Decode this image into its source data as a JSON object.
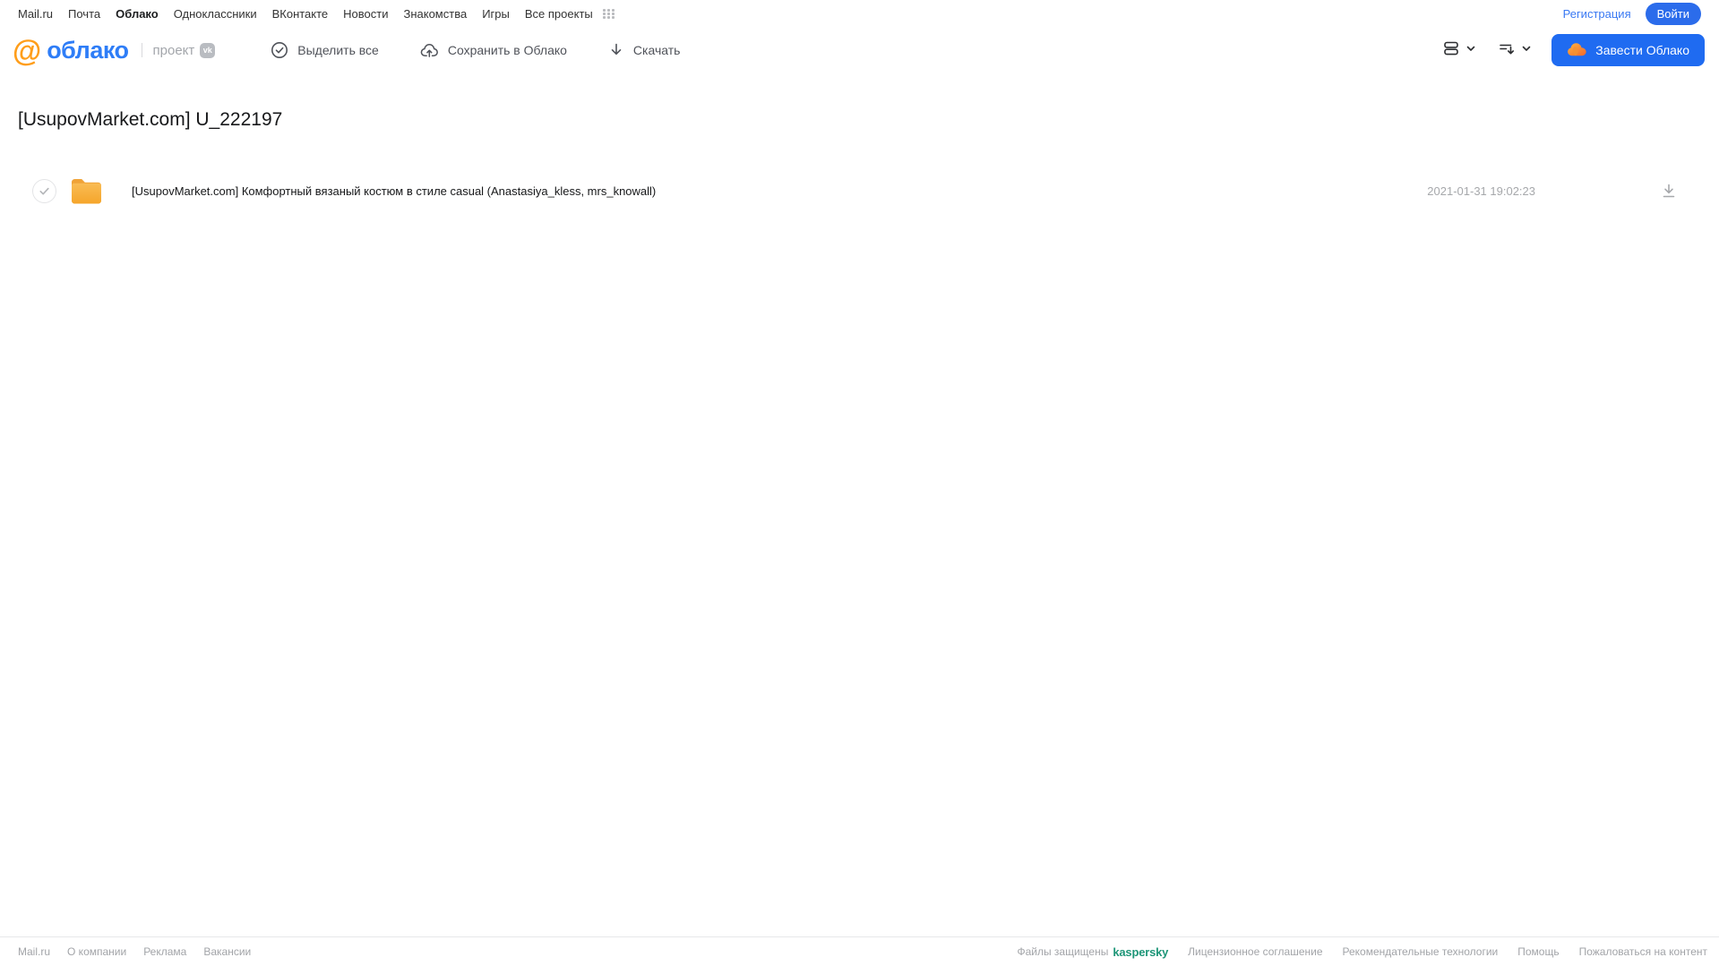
{
  "topnav": {
    "links": [
      "Mail.ru",
      "Почта",
      "Облако",
      "Одноклассники",
      "ВКонтакте",
      "Новости",
      "Знакомства",
      "Игры",
      "Все проекты"
    ],
    "active_link": "Облако",
    "registration_label": "Регистрация",
    "login_label": "Войти"
  },
  "header": {
    "logo_at": "@",
    "logo_text": "облако",
    "project_label": "проект",
    "vk_badge": "vk",
    "select_all_label": "Выделить все",
    "save_to_cloud_label": "Сохранить в Облако",
    "download_label": "Скачать",
    "get_cloud_label": "Завести Облако"
  },
  "main": {
    "title": "[UsupovMarket.com] U_222197",
    "files": [
      {
        "name": "[UsupovMarket.com] Комфортный вязаный костюм в стиле casual (Anastasiya_kless, mrs_knowall)",
        "date": "2021-01-31 19:02:23",
        "type": "folder"
      }
    ]
  },
  "footer": {
    "left_links": [
      "Mail.ru",
      "О компании",
      "Реклама",
      "Вакансии"
    ],
    "protected_label": "Файлы защищены",
    "kaspersky_label": "kaspersky",
    "right_links": [
      "Лицензионное соглашение",
      "Рекомендательные технологии",
      "Помощь",
      "Пожаловаться на контент"
    ]
  },
  "colors": {
    "accent_blue": "#1f6bf1",
    "login_blue": "#2b6ceb",
    "logo_blue": "#2e7df7",
    "logo_orange": "#ff9e1b",
    "folder_orange": "#f7b13f",
    "kaspersky_teal": "#1e9678",
    "muted_gray": "#a6a8ab"
  }
}
